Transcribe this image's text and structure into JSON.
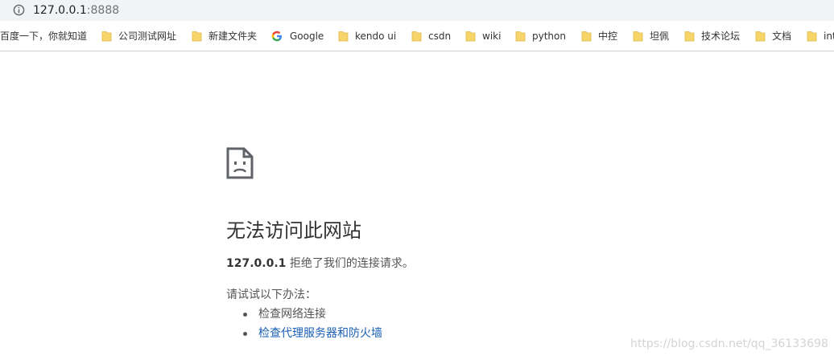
{
  "address_bar": {
    "url_host": "127.0.0.1",
    "url_port": ":8888",
    "icon": "info-icon"
  },
  "bookmarks": [
    {
      "label": "百度一下，你就知道",
      "icon": "none"
    },
    {
      "label": "公司测试网址",
      "icon": "folder-icon"
    },
    {
      "label": "新建文件夹",
      "icon": "folder-icon"
    },
    {
      "label": "Google",
      "icon": "google-icon"
    },
    {
      "label": "kendo ui",
      "icon": "folder-icon"
    },
    {
      "label": "csdn",
      "icon": "folder-icon"
    },
    {
      "label": "wiki",
      "icon": "folder-icon"
    },
    {
      "label": "python",
      "icon": "folder-icon"
    },
    {
      "label": "中控",
      "icon": "folder-icon"
    },
    {
      "label": "坦佩",
      "icon": "folder-icon"
    },
    {
      "label": "技术论坛",
      "icon": "folder-icon"
    },
    {
      "label": "文档",
      "icon": "folder-icon"
    },
    {
      "label": "int",
      "icon": "folder-icon"
    }
  ],
  "error": {
    "icon": "sad-page-icon",
    "title": "无法访问此网站",
    "host": "127.0.0.1",
    "message": " 拒绝了我们的连接请求。",
    "try_label": "请试试以下办法：",
    "suggestions": [
      {
        "label": "检查网络连接",
        "link": false
      },
      {
        "label": "检查代理服务器和防火墙",
        "link": true
      }
    ]
  },
  "watermark": "https://blog.csdn.net/qq_36133698",
  "colors": {
    "omnibox_bg": "#f1f3f4",
    "folder_yellow": "#f7d56a",
    "link_blue": "#1a5fb4"
  }
}
